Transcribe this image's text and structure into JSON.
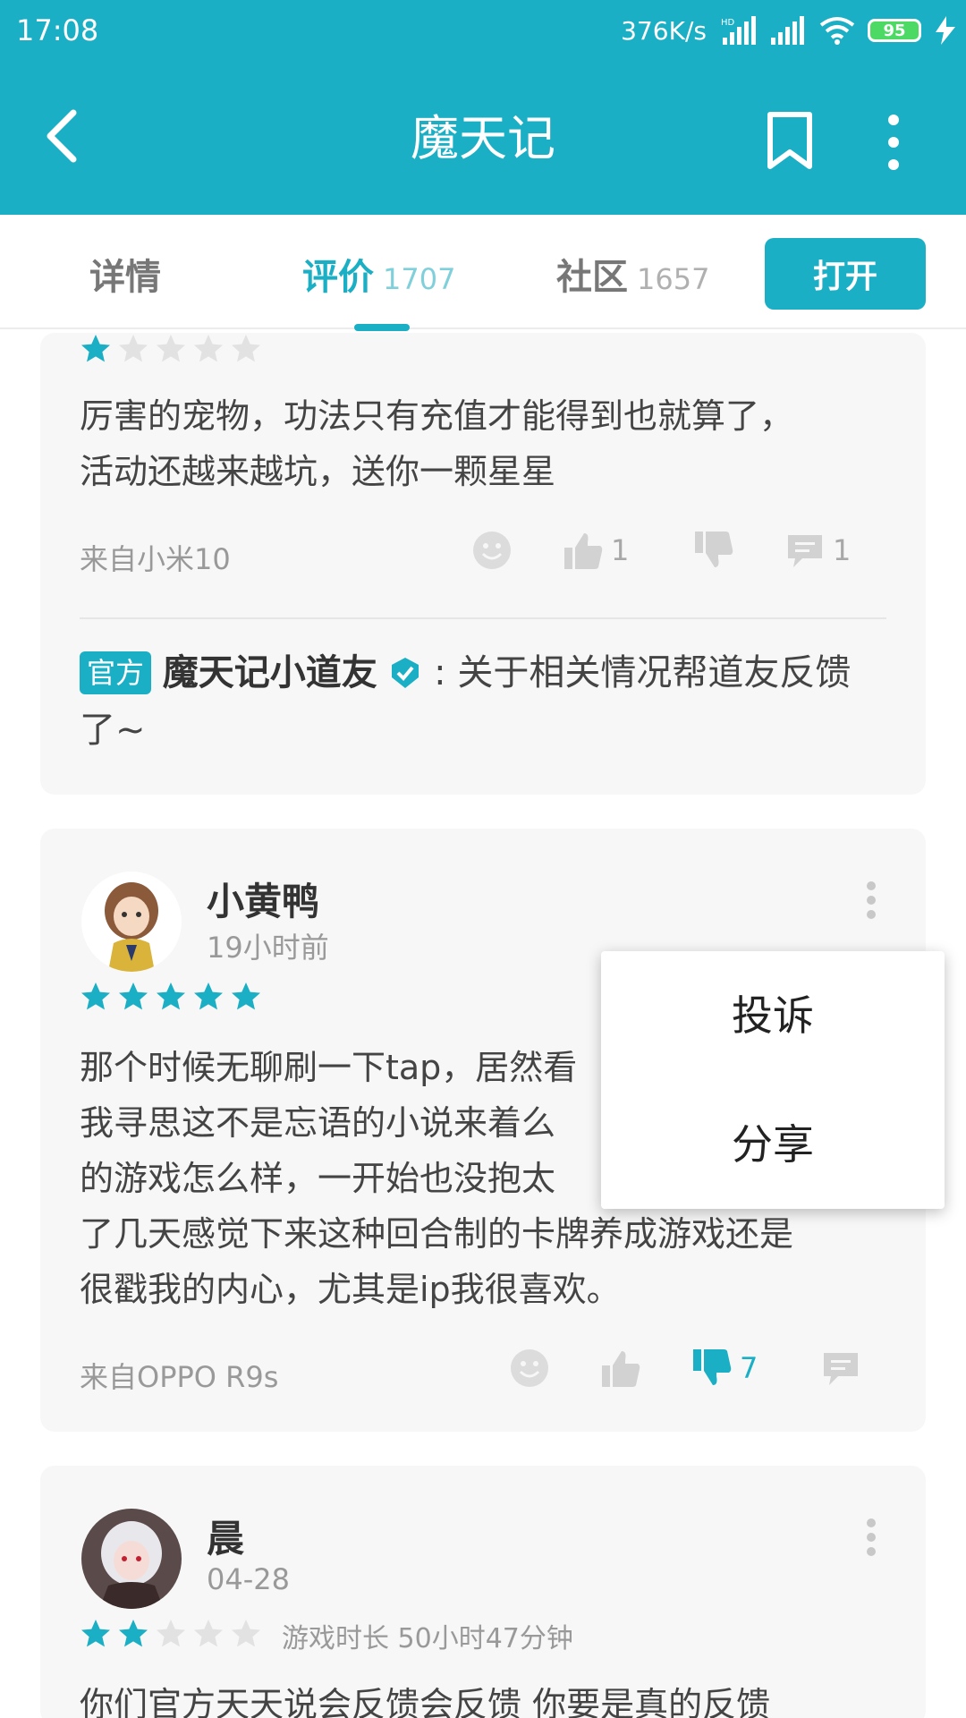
{
  "status_bar": {
    "time": "17:08",
    "net_speed": "376K/s",
    "hd": "HD",
    "battery": "95"
  },
  "header": {
    "title": "魔天记"
  },
  "tabs": [
    {
      "label": "详情",
      "count": ""
    },
    {
      "label": "评价",
      "count": "1707"
    },
    {
      "label": "社区",
      "count": "1657"
    }
  ],
  "open_button": "打开",
  "review1": {
    "rating": 1,
    "text": "厉害的宠物，功法只有充值才能得到也就算了，\n活动还越来越坑，送你一颗星星",
    "source": "来自小米10",
    "likes": "1",
    "comments": "1",
    "official_badge": "官方",
    "official_name": "魔天记小道友",
    "official_reply_line1": ": 关于相关情况帮道友反馈",
    "official_reply_line2": "了~"
  },
  "review2": {
    "user": "小黄鸭",
    "time": "19小时前",
    "rating": 5,
    "text": "那个时候无聊刷一下tap，居然看\n我寻思这不是忘语的小说来着么\n的游戏怎么样，一开始也没抱太\n了几天感觉下来这种回合制的卡牌养成游戏还是\n很戳我的内心，尤其是ip我很喜欢。",
    "source": "来自OPPO R9s",
    "dislikes": "7"
  },
  "review3": {
    "user": "晨",
    "time": "04-28",
    "rating": 2,
    "playtime": "游戏时长 50小时47分钟",
    "text_preview": "你们官方天天说会反馈会反馈 你要是真的反馈"
  },
  "popup_menu": {
    "report": "投诉",
    "share": "分享"
  },
  "colors": {
    "accent": "#1aafc4",
    "card_bg": "#f7f7f7",
    "star_empty": "#e2e2e2"
  }
}
